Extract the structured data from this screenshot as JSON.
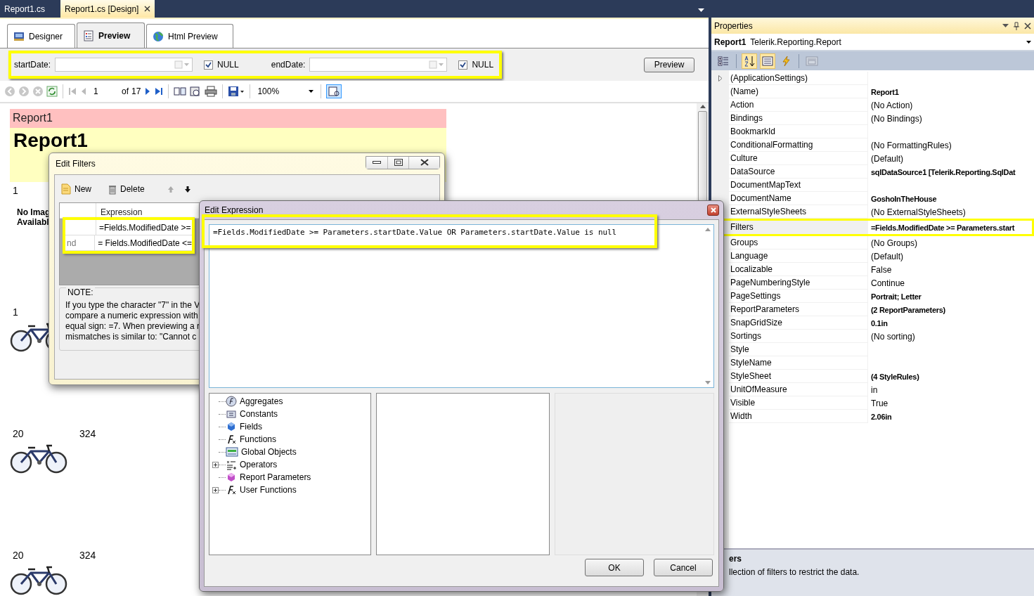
{
  "document_tabs": [
    {
      "label": "Report1.cs",
      "selected": false,
      "closable": false
    },
    {
      "label": "Report1.cs [Design]",
      "selected": true,
      "closable": true
    }
  ],
  "view_tabs": [
    {
      "label": "Designer",
      "kind": "designer",
      "selected": false
    },
    {
      "label": "Preview",
      "kind": "preview",
      "selected": true
    },
    {
      "label": "Html Preview",
      "kind": "html",
      "selected": false
    }
  ],
  "parameters": {
    "highlighted": true,
    "items": [
      {
        "label": "startDate:",
        "null_label": "NULL",
        "null_checked": true
      },
      {
        "label": "endDate:",
        "null_label": "NULL",
        "null_checked": true
      }
    ],
    "preview_button": "Preview"
  },
  "viewer_toolbar": {
    "page": "1",
    "of_label": "of",
    "page_count": "17",
    "zoom": "100%"
  },
  "report": {
    "header": "Report1",
    "title": "Report1",
    "records": [
      {
        "number": "1",
        "kind": "no_image",
        "no_image_lines": [
          "No Imag",
          "Availabl"
        ]
      },
      {
        "number": "1",
        "kind": "picture"
      },
      {
        "number": "20",
        "quantity": "324",
        "kind": "picture"
      },
      {
        "number": "20",
        "quantity": "324",
        "kind": "picture"
      }
    ]
  },
  "edit_filters": {
    "title": "Edit Filters",
    "toolbar": [
      {
        "label": "New",
        "kind": "new"
      },
      {
        "label": "Delete",
        "kind": "delete"
      }
    ],
    "move_buttons": [
      {
        "kind": "up",
        "disabled": true
      },
      {
        "kind": "down",
        "disabled": false
      }
    ],
    "grid": {
      "highlighted": true,
      "column_2": "Expression",
      "rows": [
        {
          "expression": "=Fields.ModifiedDate >="
        },
        {
          "operator": "nd",
          "expression": "= Fields.ModifiedDate <="
        }
      ]
    },
    "note": {
      "title": "NOTE:",
      "lines": [
        "If you type the character \"7\" in the V",
        "compare a numeric expression with",
        "equal sign: =7. When previewing a r",
        "mismatches is similar to: \"Cannot c"
      ]
    }
  },
  "edit_expression": {
    "title": "Edit Expression",
    "highlighted": true,
    "expression": "=Fields.ModifiedDate >= Parameters.startDate.Value OR Parameters.startDate.Value is null",
    "tree": [
      {
        "label": "Aggregates",
        "kind": "aggregate",
        "expandable": false
      },
      {
        "label": "Constants",
        "kind": "constant",
        "expandable": false
      },
      {
        "label": "Fields",
        "kind": "field",
        "expandable": false
      },
      {
        "label": "Functions",
        "kind": "function",
        "expandable": false
      },
      {
        "label": "Global Objects",
        "kind": "global",
        "expandable": false
      },
      {
        "label": "Operators",
        "kind": "operator",
        "expandable": true
      },
      {
        "label": "Report Parameters",
        "kind": "parameter",
        "expandable": false
      },
      {
        "label": "User Functions",
        "kind": "function",
        "expandable": true
      }
    ],
    "buttons": [
      "OK",
      "Cancel"
    ]
  },
  "properties": {
    "title": "Properties",
    "object_name": "Report1",
    "object_type": "Telerik.Reporting.Report",
    "toolbar_buttons": [
      {
        "kind": "categorized",
        "selected": false,
        "disabled": false
      },
      {
        "kind": "alphabetical",
        "selected": true,
        "disabled": false
      },
      {
        "kind": "properties",
        "selected": true,
        "disabled": false
      },
      {
        "kind": "events",
        "selected": false,
        "disabled": false
      },
      {
        "kind": "pages",
        "selected": false,
        "disabled": true
      }
    ],
    "rows": [
      {
        "name": "(ApplicationSettings)",
        "expandable": true,
        "selected": false,
        "highlighted": false
      },
      {
        "name": "(Name)",
        "value": "Report1",
        "bold": true,
        "selected": false,
        "highlighted": false
      },
      {
        "name": "Action",
        "value": "(No Action)",
        "bold": false,
        "selected": false,
        "highlighted": false
      },
      {
        "name": "Bindings",
        "value": "(No Bindings)",
        "bold": false,
        "selected": false,
        "highlighted": false
      },
      {
        "name": "BookmarkId",
        "selected": false,
        "highlighted": false
      },
      {
        "name": "ConditionalFormatting",
        "value": "(No FormattingRules)",
        "bold": false,
        "selected": false,
        "highlighted": false
      },
      {
        "name": "Culture",
        "value": "(Default)",
        "bold": false,
        "selected": false,
        "highlighted": false
      },
      {
        "name": "DataSource",
        "value": "sqlDataSource1 [Telerik.Reporting.SqlDat",
        "bold": true,
        "selected": false,
        "highlighted": false
      },
      {
        "name": "DocumentMapText",
        "selected": false,
        "highlighted": false
      },
      {
        "name": "DocumentName",
        "value": "GoshoInTheHouse",
        "bold": true,
        "selected": false,
        "highlighted": false
      },
      {
        "name": "ExternalStyleSheets",
        "value": "(No ExternalStyleSheets)",
        "bold": false,
        "selected": false,
        "highlighted": false
      },
      {
        "name": "Filters",
        "value": "=Fields.ModifiedDate >= Parameters.start",
        "bold": true,
        "selected": true,
        "highlighted": true
      },
      {
        "name": "Groups",
        "value": "(No Groups)",
        "bold": false,
        "selected": false,
        "highlighted": false
      },
      {
        "name": "Language",
        "value": "(Default)",
        "bold": false,
        "selected": false,
        "highlighted": false
      },
      {
        "name": "Localizable",
        "value": "False",
        "bold": false,
        "selected": false,
        "highlighted": false
      },
      {
        "name": "PageNumberingStyle",
        "value": "Continue",
        "bold": false,
        "selected": false,
        "highlighted": false
      },
      {
        "name": "PageSettings",
        "value": "Portrait; Letter",
        "bold": true,
        "selected": false,
        "highlighted": false
      },
      {
        "name": "ReportParameters",
        "value": "(2 ReportParameters)",
        "bold": true,
        "selected": false,
        "highlighted": false
      },
      {
        "name": "SnapGridSize",
        "value": "0.1in",
        "bold": true,
        "selected": false,
        "highlighted": false
      },
      {
        "name": "Sortings",
        "value": "(No sorting)",
        "bold": false,
        "selected": false,
        "highlighted": false
      },
      {
        "name": "Style",
        "selected": false,
        "highlighted": false
      },
      {
        "name": "StyleName",
        "selected": false,
        "highlighted": false
      },
      {
        "name": "StyleSheet",
        "value": "(4 StyleRules)",
        "bold": true,
        "selected": false,
        "highlighted": false
      },
      {
        "name": "UnitOfMeasure",
        "value": "in",
        "bold": false,
        "selected": false,
        "highlighted": false
      },
      {
        "name": "Visible",
        "value": "True",
        "bold": false,
        "selected": false,
        "highlighted": false
      },
      {
        "name": "Width",
        "value": "2.06in",
        "bold": true,
        "selected": false,
        "highlighted": false
      }
    ],
    "description": {
      "title": "ers",
      "text": "llection of filters to restrict the data."
    }
  }
}
